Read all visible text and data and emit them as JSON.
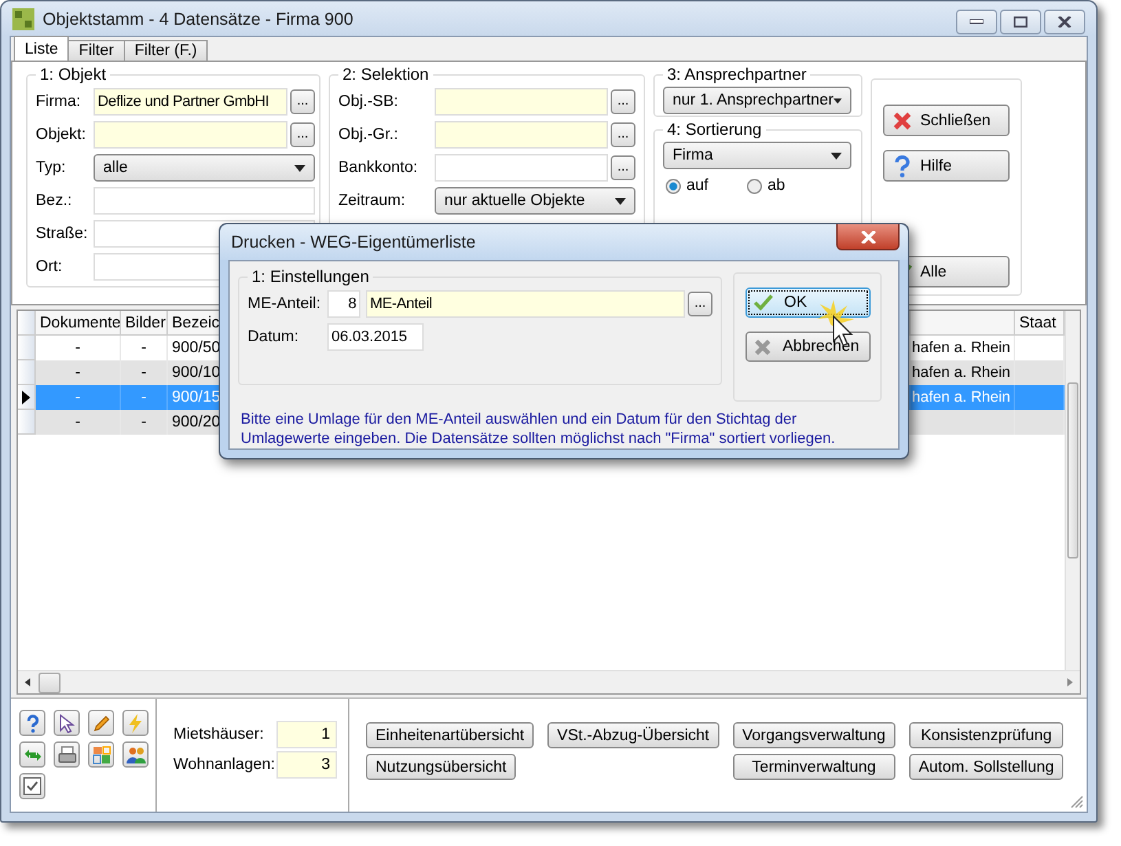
{
  "window": {
    "title": "Objektstamm - 4 Datensätze - Firma 900"
  },
  "tabs": [
    {
      "label": "Liste",
      "selected": true
    },
    {
      "label": "Filter",
      "selected": false
    },
    {
      "label": "Filter (F.)",
      "selected": false
    }
  ],
  "objekt_group": {
    "title": "1: Objekt",
    "fields": [
      {
        "kind": "lookup",
        "label": "Firma:",
        "value": "Deflize und Partner GmbHI",
        "button": "...",
        "highlighted": true
      },
      {
        "kind": "lookup",
        "label": "Objekt:",
        "button": "...",
        "highlighted": true
      },
      {
        "kind": "dropdown",
        "label": "Typ:",
        "value": "alle"
      },
      {
        "kind": "text",
        "label": "Bez.:",
        "highlighted": false
      },
      {
        "kind": "text",
        "label": "Straße:",
        "highlighted": false
      },
      {
        "kind": "text",
        "label": "Ort:",
        "highlighted": false
      }
    ]
  },
  "selektion_group": {
    "title": "2: Selektion",
    "fields": [
      {
        "kind": "lookup",
        "label": "Obj.-SB:",
        "button": "...",
        "highlighted": true
      },
      {
        "kind": "lookup",
        "label": "Obj.-Gr.:",
        "button": "...",
        "highlighted": true
      },
      {
        "kind": "lookup",
        "label": "Bankkonto:",
        "button": "...",
        "highlighted": false
      },
      {
        "kind": "dropdown",
        "label": "Zeitraum:",
        "value": "nur aktuelle Objekte"
      }
    ]
  },
  "ansprechpartner_group": {
    "title": "3: Ansprechpartner",
    "value": "nur 1. Ansprechpartner"
  },
  "sortierung_group": {
    "title": "4: Sortierung",
    "value": "Firma",
    "options": [
      {
        "label": "auf",
        "selected": true
      },
      {
        "label": "ab",
        "selected": false
      }
    ]
  },
  "action_buttons": [
    {
      "kind": "close",
      "label": "Schließen"
    },
    {
      "kind": "help",
      "label": "Hilfe"
    },
    {
      "kind": "all",
      "label": "Alle"
    }
  ],
  "table": {
    "columns": [
      "Dokumente",
      "Bilder",
      "Bezeic",
      "Staat"
    ],
    "rows": [
      {
        "dokumente": "-",
        "bilder": "-",
        "bezeichnung": "900/50",
        "column_4": "hafen a. Rhein",
        "selected": false
      },
      {
        "dokumente": "-",
        "bilder": "-",
        "bezeichnung": "900/10",
        "column_4": "hafen a. Rhein",
        "selected": false
      },
      {
        "dokumente": "-",
        "bilder": "-",
        "bezeichnung": "900/15",
        "column_4": "hafen a. Rhein",
        "selected": true
      },
      {
        "dokumente": "-",
        "bilder": "-",
        "bezeichnung": "900/20",
        "selected": false
      }
    ]
  },
  "toolbar": [
    {
      "kind": "help"
    },
    {
      "kind": "pointer"
    },
    {
      "kind": "pencil"
    },
    {
      "kind": "lightning"
    },
    {
      "kind": "refresh"
    },
    {
      "kind": "printer"
    },
    {
      "kind": "layout"
    },
    {
      "kind": "people"
    },
    {
      "kind": "checkbox"
    }
  ],
  "counts": [
    {
      "label": "Mietshäuser:",
      "value": "1"
    },
    {
      "label": "Wohnanlagen:",
      "value": "3"
    }
  ],
  "report_buttons": [
    [
      "Einheitenartübersicht",
      "VSt.-Abzug-Übersicht",
      "Vorgangsverwaltung",
      "Konsistenzprüfung"
    ],
    [
      "Nutzungsübersicht",
      "Terminverwaltung",
      "Autom. Sollstellung"
    ]
  ],
  "dialog": {
    "title": "Drucken - WEG-Eigentümerliste",
    "group_title": "1: Einstellungen",
    "me_anteil": {
      "label": "ME-Anteil:",
      "number": "8",
      "value": "ME-Anteil",
      "button": "..."
    },
    "datum": {
      "label": "Datum:",
      "value": "06.03.2015"
    },
    "buttons": [
      {
        "kind": "ok",
        "label": "OK",
        "focused": true
      },
      {
        "kind": "cancel",
        "label": "Abbrechen",
        "focused": false
      }
    ],
    "note": "Bitte eine Umlage für den ME-Anteil auswählen und ein Datum für den Stichtag der Umlagewerte eingeben. Die Datensätze sollten möglichst nach \"Firma\" sortiert vorliegen."
  }
}
